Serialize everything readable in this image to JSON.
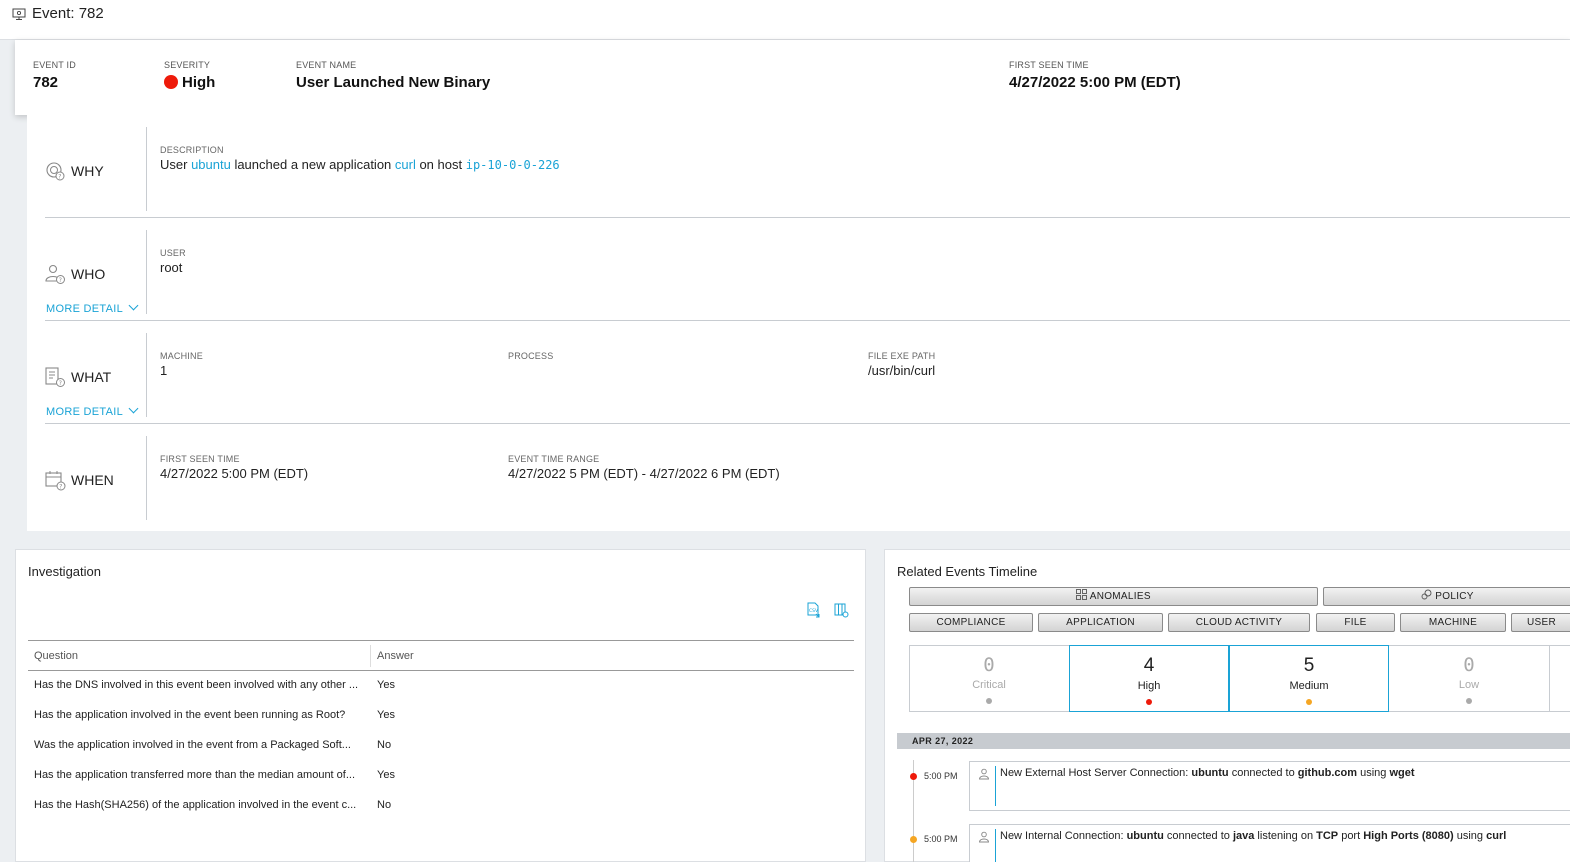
{
  "window": {
    "title": "Event: 782"
  },
  "header": {
    "event_id_label": "EVENT ID",
    "event_id": "782",
    "severity_label": "SEVERITY",
    "severity": "High",
    "severity_color": "#ee1a0a",
    "event_name_label": "EVENT NAME",
    "event_name": "User Launched New Binary",
    "first_seen_label": "FIRST SEEN TIME",
    "first_seen": "4/27/2022 5:00 PM (EDT)"
  },
  "why": {
    "name": "WHY",
    "description_label": "DESCRIPTION",
    "d1": "User ",
    "d_user": "ubuntu",
    "d2": " launched a new application ",
    "d_app": "curl",
    "d3": " on host ",
    "d_host": "ip-10-0-0-226"
  },
  "who": {
    "name": "WHO",
    "user_label": "USER",
    "user": "root",
    "more": "MORE DETAIL"
  },
  "what": {
    "name": "WHAT",
    "machine_label": "MACHINE",
    "machine": "1",
    "process_label": "PROCESS",
    "path_label": "FILE EXE PATH",
    "path": "/usr/bin/curl",
    "more": "MORE DETAIL"
  },
  "when": {
    "name": "WHEN",
    "first_label": "FIRST SEEN TIME",
    "first": "4/27/2022 5:00 PM (EDT)",
    "range_label": "EVENT TIME RANGE",
    "range": "4/27/2022 5 PM (EDT) - 4/27/2022 6 PM (EDT)"
  },
  "investigation": {
    "title": "Investigation",
    "col_question": "Question",
    "col_answer": "Answer",
    "rows": [
      {
        "q": "Has the DNS involved in this event been involved with any other ...",
        "a": "Yes"
      },
      {
        "q": "Has the application involved in the event been running as Root?",
        "a": "Yes"
      },
      {
        "q": "Was the application involved in the event from a Packaged Soft...",
        "a": "No"
      },
      {
        "q": "Has the application transferred more than the median amount of...",
        "a": "Yes"
      },
      {
        "q": "Has the Hash(SHA256) of the application involved in the event c...",
        "a": "No"
      }
    ]
  },
  "timeline": {
    "title": "Related Events Timeline",
    "filters_row1": [
      "ANOMALIES",
      "POLICY"
    ],
    "filters_row2": [
      "COMPLIANCE",
      "APPLICATION",
      "CLOUD ACTIVITY",
      "FILE",
      "MACHINE",
      "USER"
    ],
    "severity_counts": [
      {
        "label": "Critical",
        "count": "0",
        "color": "#aaaaaa"
      },
      {
        "label": "High",
        "count": "4",
        "color": "#ee1a0a"
      },
      {
        "label": "Medium",
        "count": "5",
        "color": "#f5a623"
      },
      {
        "label": "Low",
        "count": "0",
        "color": "#aaaaaa"
      }
    ],
    "date": "APR 27, 2022",
    "events": [
      {
        "time": "5:00 PM",
        "color": "#ee1a0a",
        "t1": "New External Host Server Connection: ",
        "b1": "ubuntu",
        "t2": " connected to ",
        "b2": "github.com",
        "t3": " using ",
        "b3": "wget",
        "t4": "",
        "b4": "",
        "t5": "",
        "b5": "",
        "t6": ""
      },
      {
        "time": "5:00 PM",
        "color": "#f5a623",
        "t1": "New Internal Connection: ",
        "b1": "ubuntu",
        "t2": " connected to ",
        "b2": "java",
        "t3": " listening on ",
        "b3": "TCP",
        "t4": " port ",
        "b4": "High Ports (8080)",
        "t5": " using ",
        "b5": "curl",
        "t6": ""
      }
    ]
  }
}
